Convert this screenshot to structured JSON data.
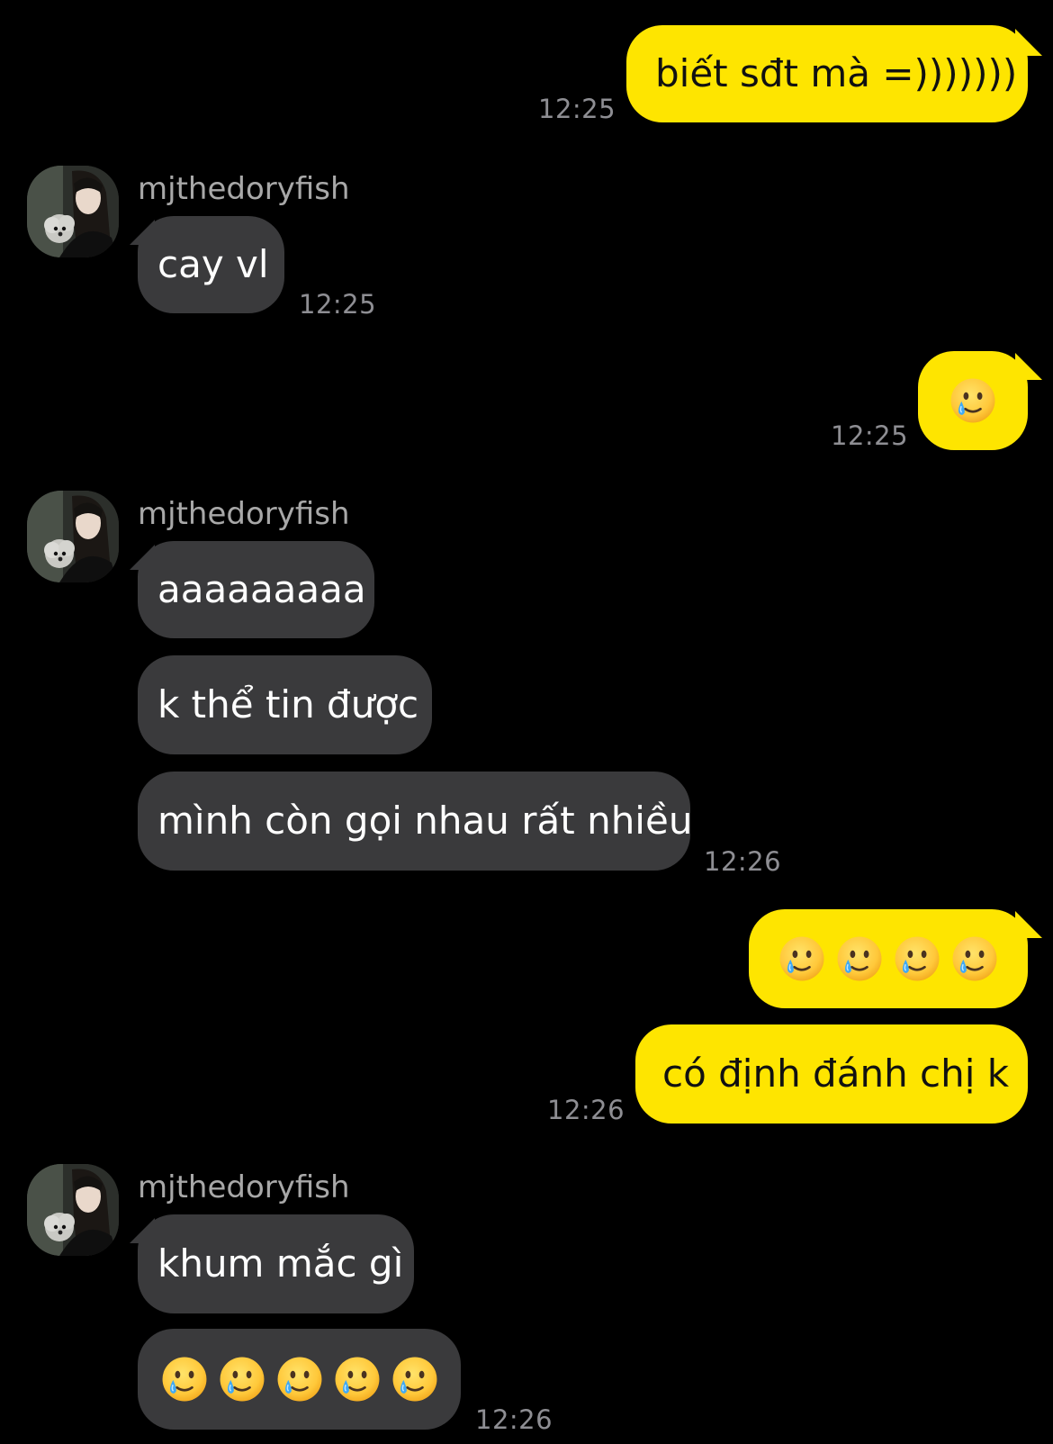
{
  "contact": {
    "name": "mjthedoryfish",
    "avatar_icon": "profile-photo-icon"
  },
  "colors": {
    "background": "#000000",
    "me_bubble": "#FEE500",
    "other_bubble": "#3a3a3c",
    "timestamp": "#8e8e93"
  },
  "messages": [
    {
      "from": "me",
      "text": "biết sđt mà =)))))))",
      "time": "12:25"
    },
    {
      "from": "mjthedoryfish",
      "text": "cay vl",
      "time": "12:25"
    },
    {
      "from": "me",
      "emoji": "crying-smile-icon",
      "emoji_count": 1,
      "time": "12:25"
    },
    {
      "from": "mjthedoryfish",
      "text": "aaaaaaaaa"
    },
    {
      "from": "mjthedoryfish",
      "text": "k thể tin được"
    },
    {
      "from": "mjthedoryfish",
      "text": "mình còn gọi nhau rất nhiều",
      "time": "12:26"
    },
    {
      "from": "me",
      "emoji": "crying-smile-icon",
      "emoji_count": 4
    },
    {
      "from": "me",
      "text": "có định đánh chị k",
      "time": "12:26"
    },
    {
      "from": "mjthedoryfish",
      "text": "khum mắc gì"
    },
    {
      "from": "mjthedoryfish",
      "emoji": "crying-smile-icon",
      "emoji_count": 5,
      "time": "12:26"
    }
  ]
}
